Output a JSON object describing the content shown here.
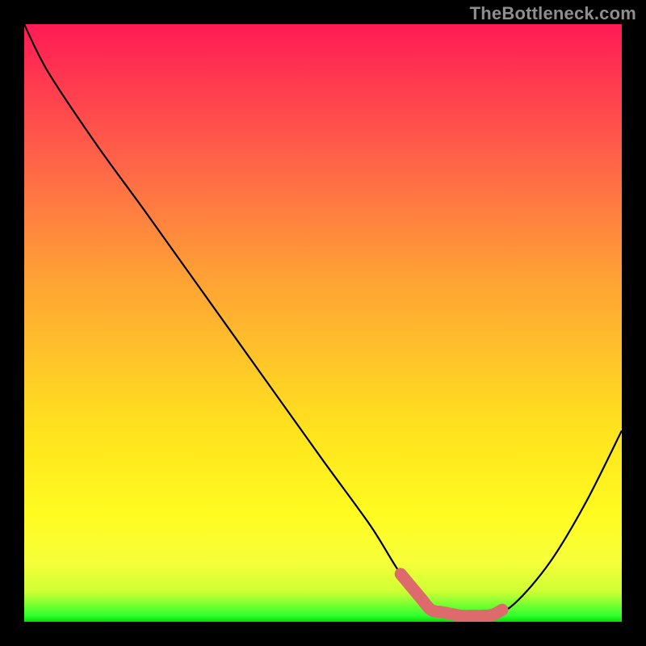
{
  "watermark": "TheBottleneck.com",
  "chart_data": {
    "type": "line",
    "title": "",
    "xlabel": "",
    "ylabel": "",
    "xlim": [
      0,
      100
    ],
    "ylim": [
      0,
      100
    ],
    "curve": {
      "x": [
        0,
        4,
        12,
        20,
        30,
        40,
        50,
        58,
        63,
        68,
        73,
        78,
        82,
        88,
        94,
        100
      ],
      "y_pct": [
        100,
        92,
        80,
        69,
        55,
        41,
        27,
        16,
        8,
        2,
        1,
        1,
        3,
        10,
        20,
        32
      ]
    },
    "highlight_range_x": [
      63,
      80
    ],
    "background_gradient": {
      "top": "#ff1a56",
      "mid": "#ffe31e",
      "bottom": "#00e000"
    },
    "colors": {
      "curve": "#000000",
      "highlight": "#dd6b6b",
      "frame": "#000000"
    }
  }
}
